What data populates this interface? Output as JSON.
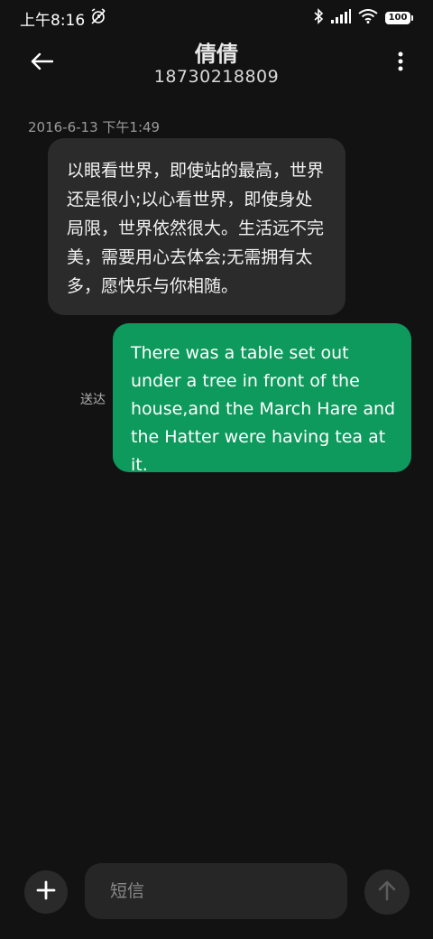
{
  "status_bar": {
    "time": "上午8:16",
    "battery": "100",
    "icons": [
      "alarm-off-icon",
      "bluetooth-icon",
      "signal-icon",
      "wifi-icon",
      "battery-icon"
    ]
  },
  "header": {
    "contact_name": "倩倩",
    "contact_number": "18730218809",
    "icons": [
      "back-arrow-icon",
      "more-vertical-icon"
    ]
  },
  "conversation": {
    "timestamp": "2016-6-13 下午1:49",
    "messages": [
      {
        "direction": "incoming",
        "text": "以眼看世界，即使站的最高，世界还是很小;以心看世界，即使身处局限，世界依然很大。生活远不完美，需要用心去体会;无需拥有太多，愿快乐与你相随。"
      },
      {
        "direction": "outgoing",
        "text": "There was a table set out under a tree in front of the house,and the March Hare and the Hatter were having tea at it.",
        "status": "送达"
      }
    ]
  },
  "composer": {
    "placeholder": "短信",
    "icons": [
      "plus-icon",
      "send-arrow-icon"
    ]
  },
  "colors": {
    "background": "#121212",
    "incoming_bubble": "#2b2b2b",
    "outgoing_bubble": "#0e9a5d"
  }
}
